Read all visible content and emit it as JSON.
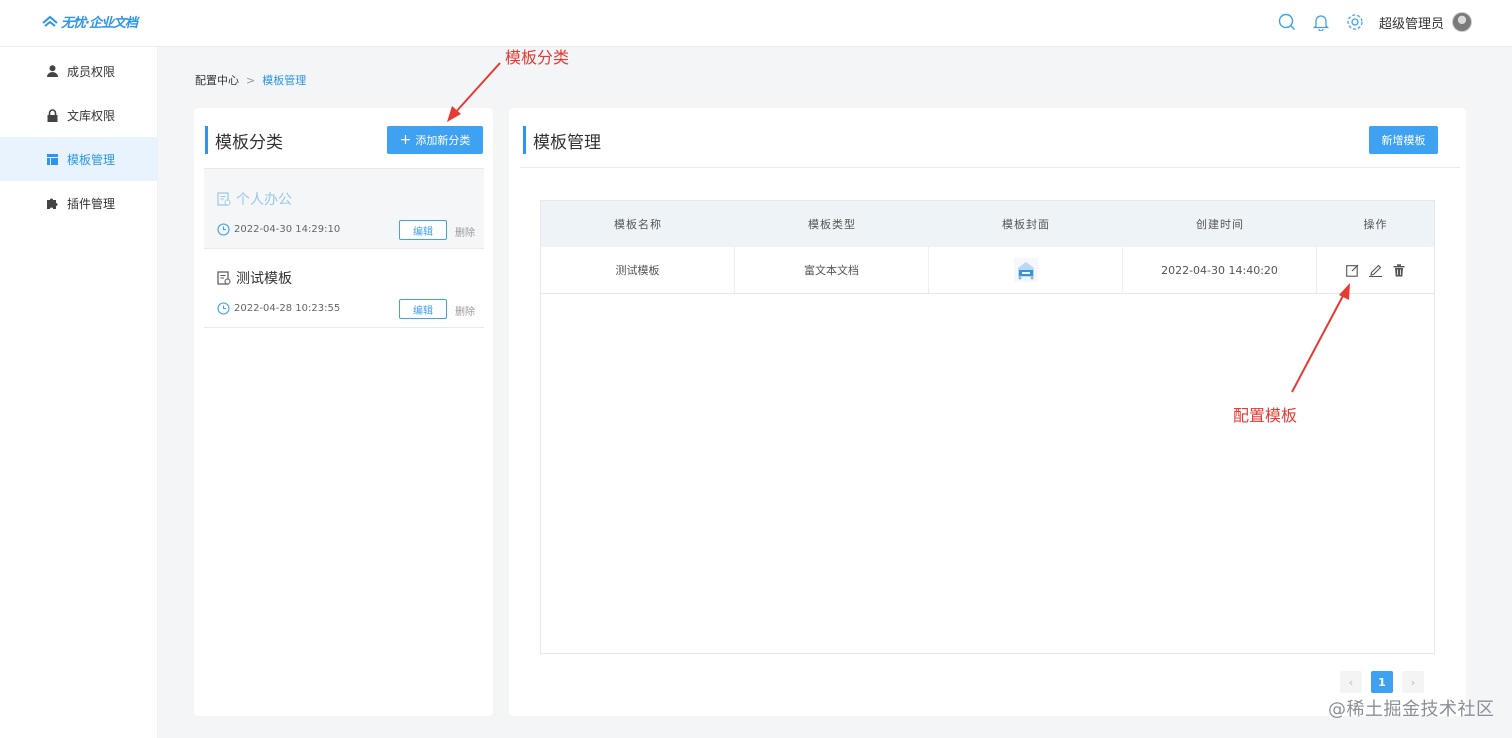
{
  "header": {
    "logo_text": "无忧·企业文档",
    "icons": [
      "search-icon",
      "bell-icon",
      "gear-icon"
    ],
    "username": "超级管理员"
  },
  "sidebar": {
    "items": [
      {
        "label": "成员权限",
        "icon": "user-icon",
        "active": false
      },
      {
        "label": "文库权限",
        "icon": "lock-icon",
        "active": false
      },
      {
        "label": "模板管理",
        "icon": "template-icon",
        "active": true
      },
      {
        "label": "插件管理",
        "icon": "puzzle-icon",
        "active": false
      }
    ]
  },
  "breadcrumb": {
    "parent": "配置中心",
    "separator": ">",
    "current": "模板管理"
  },
  "categories_panel": {
    "title": "模板分类",
    "add_button_label": "添加新分类",
    "items": [
      {
        "name": "个人办公",
        "time": "2022-04-30 14:29:10",
        "edit_label": "编辑",
        "delete_label": "删除",
        "selected": true
      },
      {
        "name": "测试模板",
        "time": "2022-04-28 10:23:55",
        "edit_label": "编辑",
        "delete_label": "删除",
        "selected": false
      }
    ]
  },
  "templates_panel": {
    "title": "模板管理",
    "new_button_label": "新增模板",
    "columns": [
      "模板名称",
      "模板类型",
      "模板封面",
      "创建时间",
      "操作"
    ],
    "rows": [
      {
        "name": "测试模板",
        "type": "富文本文档",
        "cover": "cover-thumbnail",
        "created": "2022-04-30 14:40:20",
        "actions": [
          "configure-icon",
          "edit-pencil-icon",
          "trash-icon"
        ]
      }
    ],
    "pagination": {
      "prev": "‹",
      "current_page": "1",
      "next": "›"
    }
  },
  "annotations": {
    "categories_note": "模板分类",
    "configure_note": "配置模板"
  },
  "watermark": "@稀土掘金技术社区",
  "colors": {
    "accent": "#3ea1f2",
    "annotation": "#e63a32",
    "active_bg": "#e8f3fd"
  }
}
